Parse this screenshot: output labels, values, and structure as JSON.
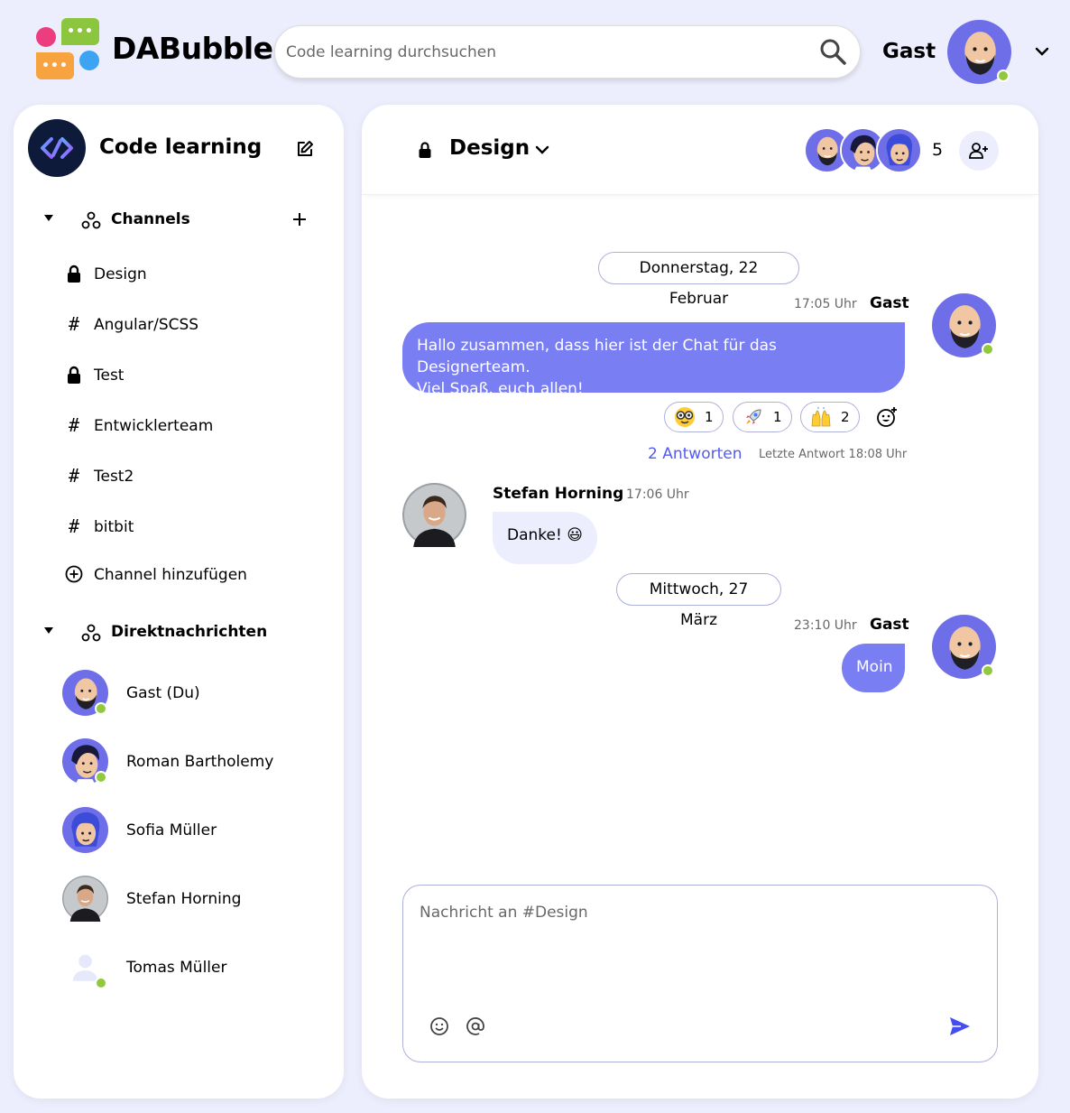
{
  "app": {
    "title": "DABubble"
  },
  "search": {
    "placeholder": "Code learning durchsuchen"
  },
  "user": {
    "name": "Gast"
  },
  "workspace": {
    "name": "Code learning"
  },
  "sidebar": {
    "channels_label": "Channels",
    "channels": [
      {
        "name": "Design",
        "icon": "lock-icon"
      },
      {
        "name": "Angular/SCSS",
        "icon": "hash-icon"
      },
      {
        "name": "Test",
        "icon": "lock-icon"
      },
      {
        "name": "Entwicklerteam",
        "icon": "hash-icon"
      },
      {
        "name": "Test2",
        "icon": "hash-icon"
      },
      {
        "name": "bitbit",
        "icon": "hash-icon"
      }
    ],
    "add_channel_label": "Channel hinzufügen",
    "dm_label": "Direktnachrichten",
    "dms": [
      {
        "name": "Gast (Du)",
        "online": true
      },
      {
        "name": "Roman Bartholemy",
        "online": true
      },
      {
        "name": "Sofia Müller",
        "online": false
      },
      {
        "name": "Stefan Horning",
        "online": false
      },
      {
        "name": "Tomas Müller",
        "online": true
      }
    ]
  },
  "chat": {
    "channel_name": "Design",
    "member_count": "5",
    "messages": [
      {
        "date": "Donnerstag, 22 Februar"
      },
      {
        "time": "17:05 Uhr",
        "author": "Gast",
        "text_line1": "Hallo zusammen, dass hier ist der Chat für das Designerteam.",
        "text_line2": "Viel Spaß, euch allen!",
        "reactions": [
          {
            "emoji": "nerd-face",
            "count": "1"
          },
          {
            "emoji": "rocket",
            "count": "1"
          },
          {
            "emoji": "raised-hands",
            "count": "2"
          }
        ],
        "replies": "2 Antworten",
        "last_reply": "Letzte Antwort 18:08 Uhr"
      },
      {
        "time": "17:06 Uhr",
        "author": "Stefan Horning",
        "text": "Danke! 😃"
      },
      {
        "date": "Mittwoch, 27 März"
      },
      {
        "time": "23:10 Uhr",
        "author": "Gast",
        "text": "Moin"
      }
    ],
    "composer_placeholder": "Nachricht an #Design"
  },
  "colors": {
    "accent": "#797ef3",
    "accent_dark": "#535af1",
    "background": "#eceefe",
    "online": "#92c83e"
  }
}
